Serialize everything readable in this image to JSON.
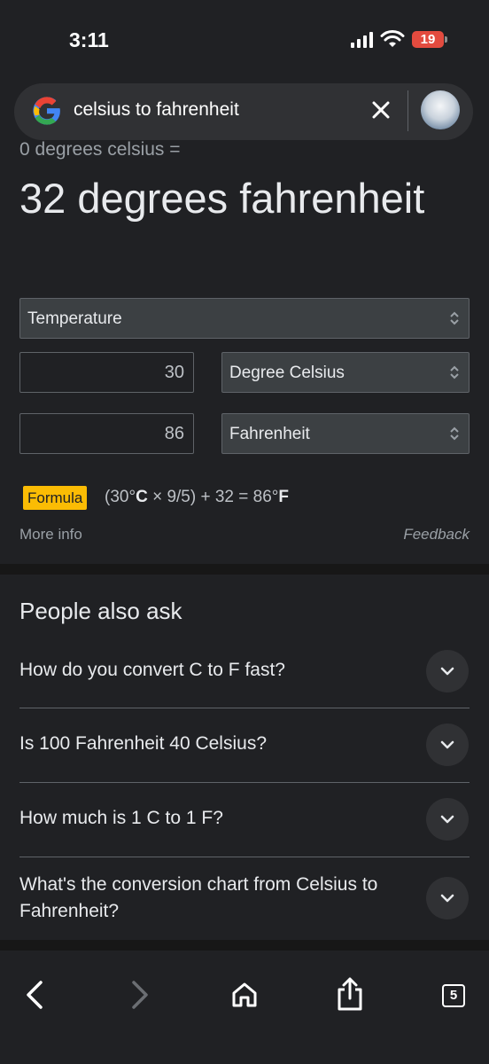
{
  "status_bar": {
    "time": "3:11",
    "battery": "19"
  },
  "search": {
    "query": "celsius to fahrenheit"
  },
  "converter": {
    "from_line": "0 degrees celsius =",
    "result": "32 degrees fahrenheit",
    "unit_type": "Temperature",
    "from_value": "30",
    "from_unit": "Degree Celsius",
    "to_value": "86",
    "to_unit": "Fahrenheit",
    "formula_label": "Formula",
    "formula": {
      "pre": "(30°",
      "c": "C",
      "mid": " × 9/5) + 32 = 86°",
      "f": "F"
    },
    "more_info": "More info",
    "feedback": "Feedback"
  },
  "people_also_ask": {
    "heading": "People also ask",
    "questions": [
      "How do you convert C to F fast?",
      "Is 100 Fahrenheit 40 Celsius?",
      "How much is 1 C to 1 F?",
      "What's the conversion chart from Celsius to Fahrenheit?"
    ]
  },
  "toolbar": {
    "tab_count": "5"
  },
  "icons": {
    "signal": "signal-icon",
    "wifi": "wifi-icon",
    "battery": "battery-icon",
    "google": "google-logo",
    "clear": "close-icon",
    "chevron": "chevron-down-icon",
    "back": "back-arrow-icon",
    "forward": "forward-arrow-icon",
    "home": "home-icon",
    "share": "share-icon",
    "tabs": "tabs-icon"
  },
  "colors": {
    "background": "#202124",
    "formula_badge": "#fbbc04",
    "battery_low": "#e34b3f"
  }
}
